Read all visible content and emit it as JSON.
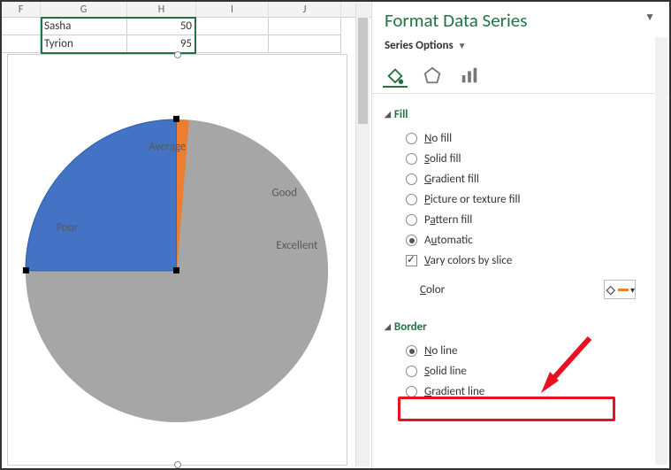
{
  "sheet": {
    "columns": [
      "F",
      "G",
      "H",
      "I",
      "J"
    ],
    "rows": [
      {
        "g": "Sasha",
        "h": 50
      },
      {
        "g": "Tyrion",
        "h": 95
      }
    ]
  },
  "chart_data": {
    "type": "pie",
    "labels": [
      "Poor",
      "Average",
      "Good",
      "Excellent"
    ],
    "note": "Only category labels are visible on the chart; slice values and exact angles are not labeled in the screenshot so no numeric values are recorded here.",
    "selected_slice": "Poor"
  },
  "pane": {
    "title": "Format Data Series",
    "subtitle": "Series Options",
    "tabs": {
      "fill_line": "Fill & Line",
      "effects": "Effects",
      "series": "Series Options"
    },
    "fill": {
      "heading": "Fill",
      "options": {
        "no_fill": "No fill",
        "solid_fill": "Solid fill",
        "gradient_fill": "Gradient fill",
        "picture_texture_fill": "Picture or texture fill",
        "pattern_fill": "Pattern fill",
        "automatic": "Automatic"
      },
      "selected": "automatic",
      "vary_colors": "Vary colors by slice",
      "vary_colors_checked": true,
      "color_label": "Color"
    },
    "border": {
      "heading": "Border",
      "options": {
        "no_line": "No line",
        "solid_line": "Solid line",
        "gradient_line": "Gradient line"
      },
      "selected": "no_line"
    }
  }
}
